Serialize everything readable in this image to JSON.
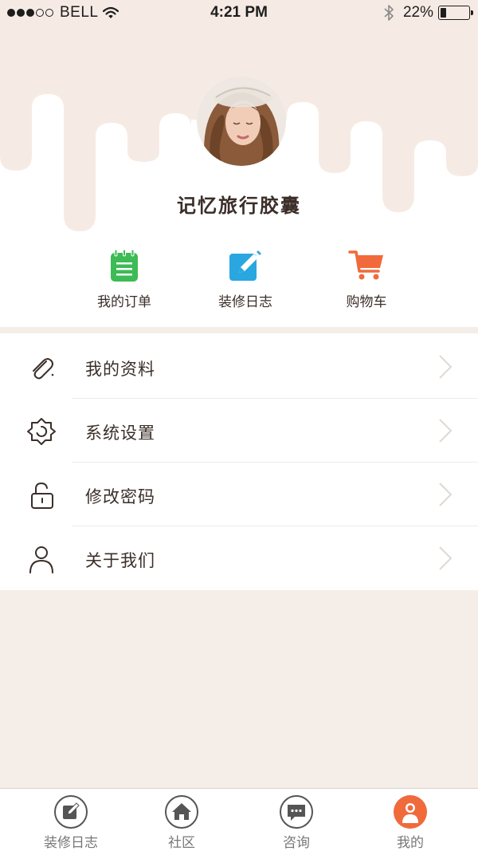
{
  "status_bar": {
    "carrier": "BELL",
    "time": "4:21 PM",
    "battery_percent": "22%",
    "battery_level": 0.22,
    "signal_bars_filled": 3,
    "signal_bars_total": 5
  },
  "profile": {
    "username": "记忆旅行胶囊",
    "avatar_icon": "avatar-photo"
  },
  "shortcuts": [
    {
      "label": "我的订单",
      "icon": "notepad-icon",
      "color": "#3dbb55"
    },
    {
      "label": "装修日志",
      "icon": "edit-icon",
      "color": "#2aa7e0"
    },
    {
      "label": "购物车",
      "icon": "cart-icon",
      "color": "#f06a3c"
    }
  ],
  "menu": {
    "items": [
      {
        "label": "我的资料",
        "icon": "paperclip-icon"
      },
      {
        "label": "系统设置",
        "icon": "gear-icon"
      },
      {
        "label": "修改密码",
        "icon": "lock-icon"
      },
      {
        "label": "关于我们",
        "icon": "user-icon"
      }
    ]
  },
  "tabbar": {
    "tabs": [
      {
        "label": "装修日志",
        "icon": "edit-icon",
        "active": false
      },
      {
        "label": "社区",
        "icon": "home-icon",
        "active": false
      },
      {
        "label": "咨询",
        "icon": "chat-icon",
        "active": false
      },
      {
        "label": "我的",
        "icon": "user-icon",
        "active": true
      }
    ],
    "active_color": "#f06a3c",
    "inactive_color": "#555555"
  },
  "colors": {
    "background": "#f5eee8",
    "header_drip": "#f6ebe4"
  }
}
